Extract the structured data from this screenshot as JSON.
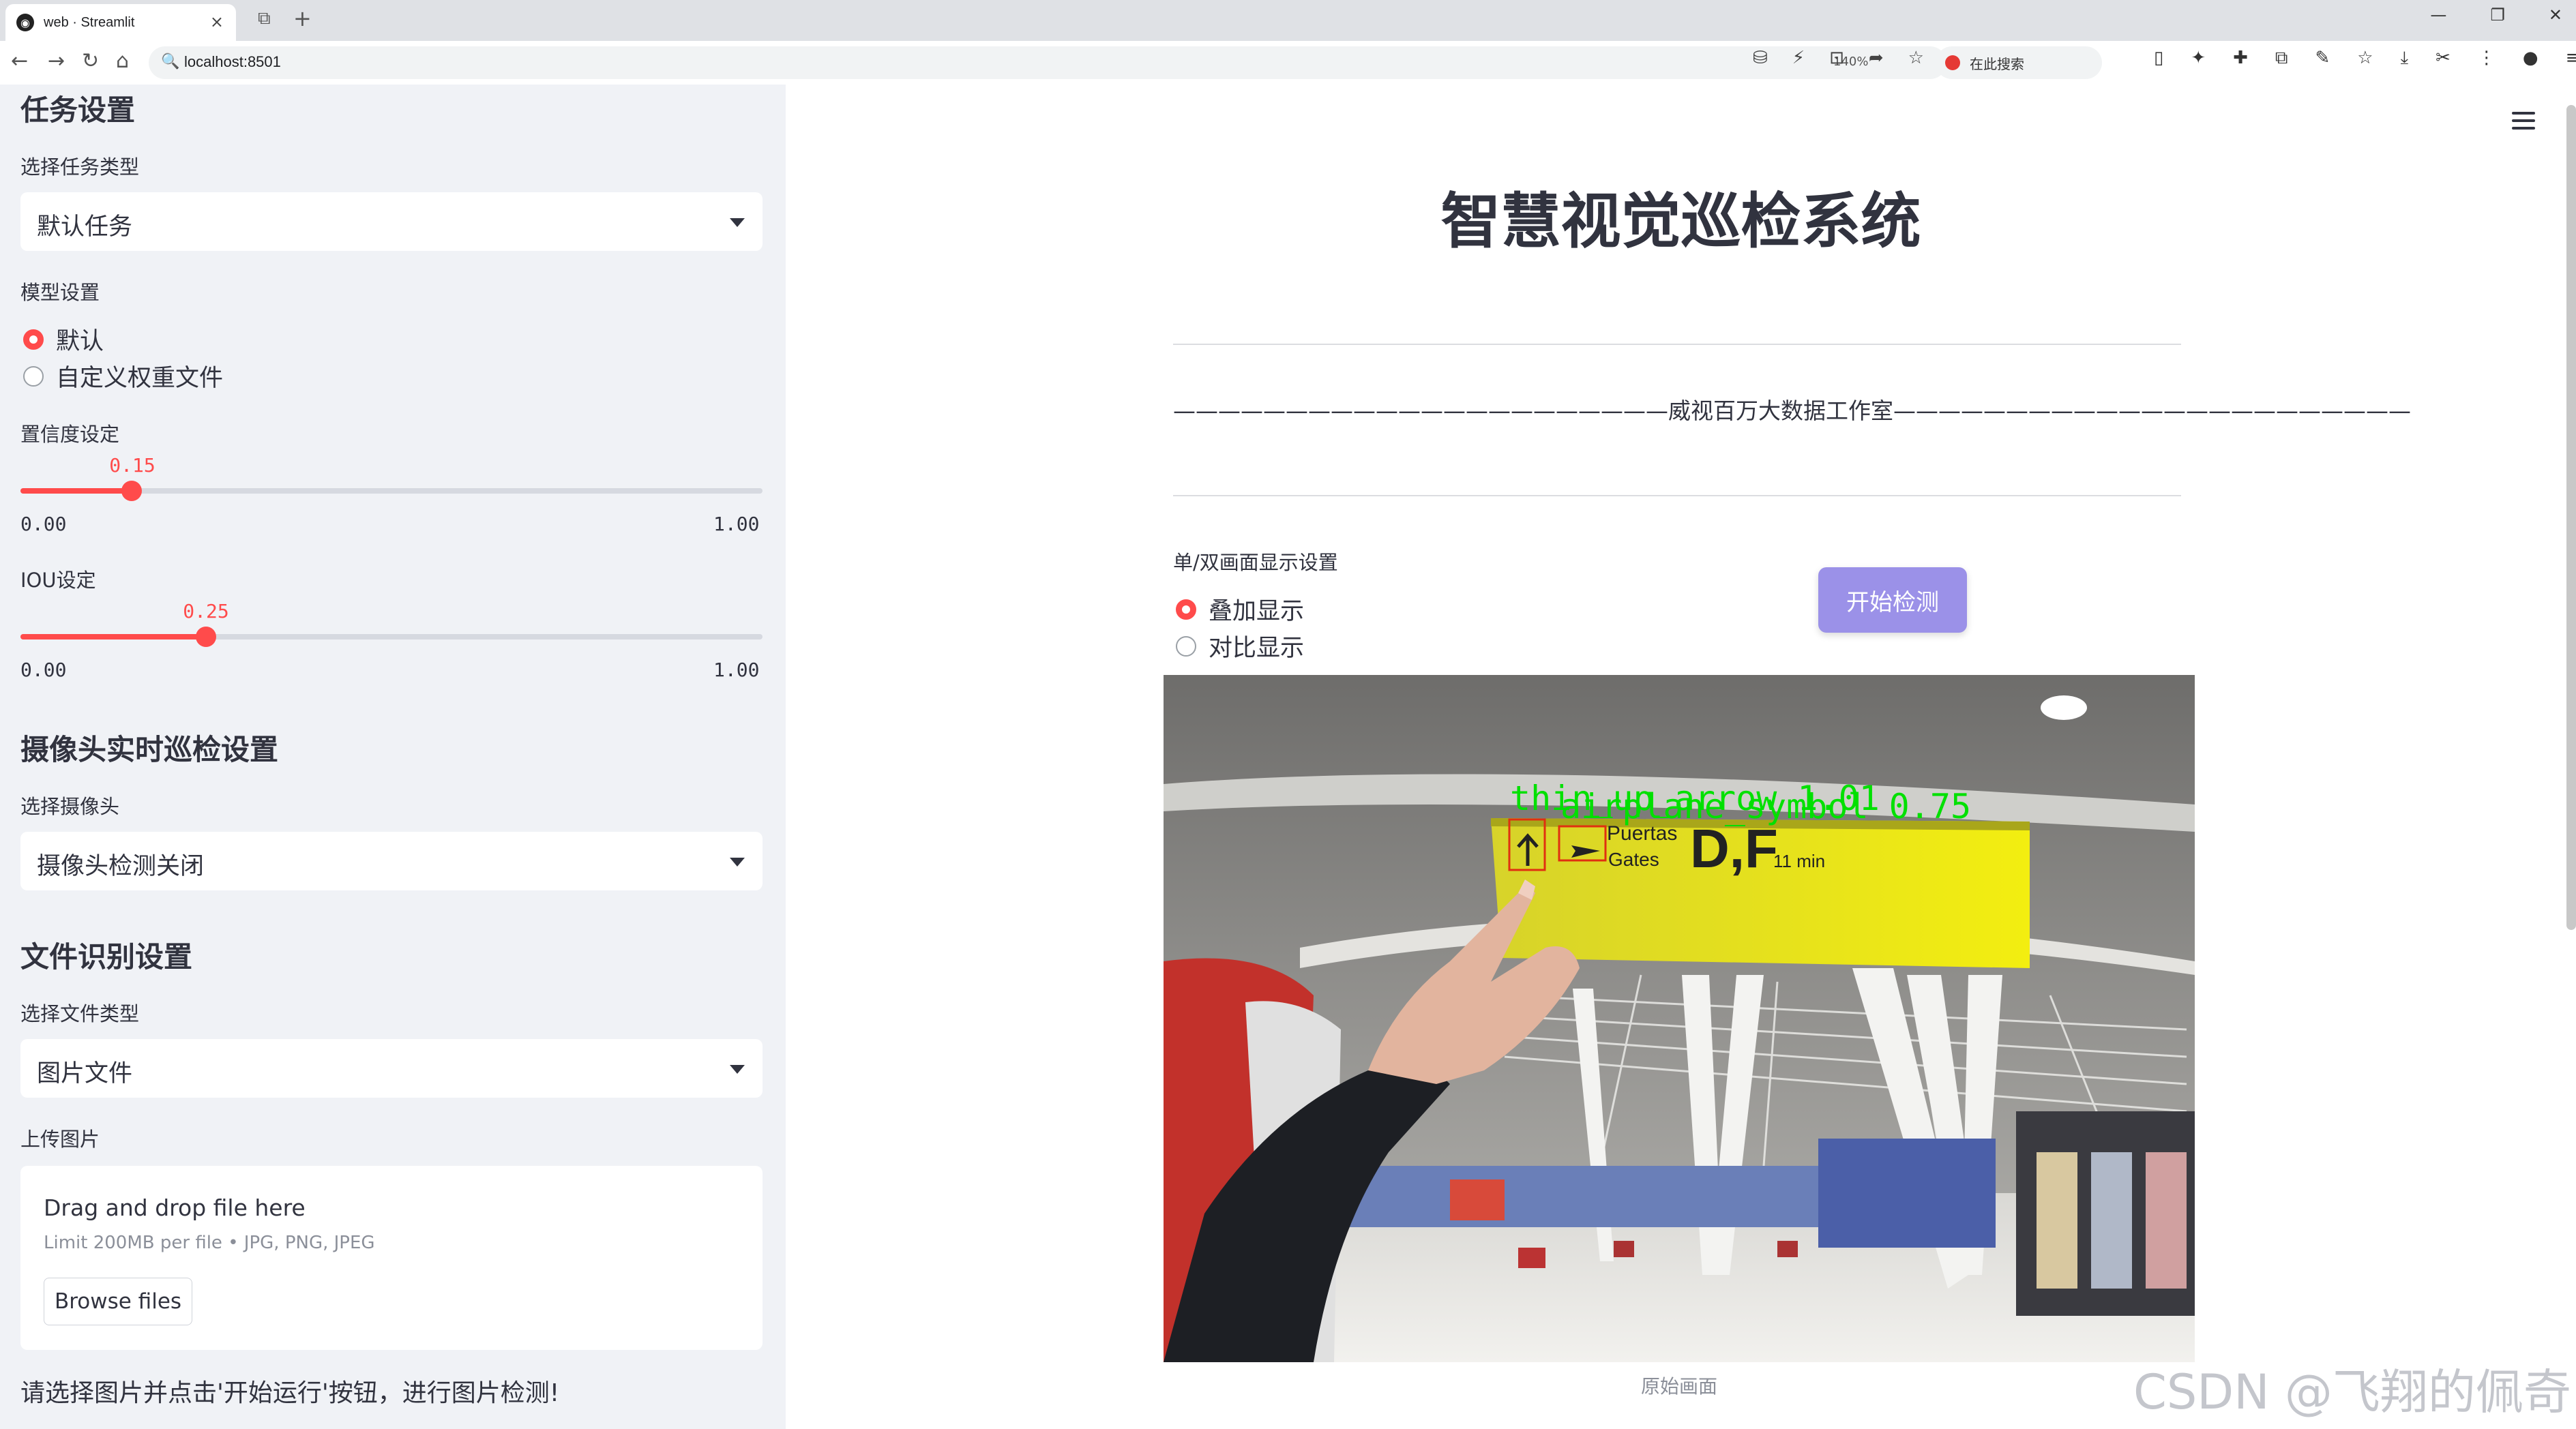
{
  "browser": {
    "tab_title": "web · Streamlit",
    "url": "localhost:8501",
    "zoom": "140%",
    "search_placeholder": "在此搜索"
  },
  "sidebar": {
    "task_section": "任务设置",
    "task_type_label": "选择任务类型",
    "task_type_value": "默认任务",
    "model_label": "模型设置",
    "model_options": [
      "默认",
      "自定义权重文件"
    ],
    "model_selected": 0,
    "conf_label": "置信度设定",
    "conf_value": "0.15",
    "conf_fraction": 0.15,
    "slider_min": "0.00",
    "slider_max": "1.00",
    "iou_label": "IOU设定",
    "iou_value": "0.25",
    "iou_fraction": 0.25,
    "camera_section": "摄像头实时巡检设置",
    "camera_label": "选择摄像头",
    "camera_value": "摄像头检测关闭",
    "file_section": "文件识别设置",
    "file_type_label": "选择文件类型",
    "file_type_value": "图片文件",
    "upload_label": "上传图片",
    "upload_title": "Drag and drop file here",
    "upload_limit": "Limit 200MB per file • JPG, PNG, JPEG",
    "browse_label": "Browse files",
    "hint": "请选择图片并点击'开始运行'按钮，进行图片检测!"
  },
  "main": {
    "title": "智慧视觉巡检系统",
    "studio_line": "——————————————————————威视百万大数据工作室———————————————————————",
    "display_mode_label": "单/双画面显示设置",
    "display_options": [
      "叠加显示",
      "对比显示"
    ],
    "display_selected": 0,
    "start_button": "开始检测",
    "caption": "原始画面",
    "sign_text_1": "Puertas",
    "sign_text_2": "Gates",
    "sign_gate": "D,F",
    "sign_walk": "11 min",
    "detections": [
      {
        "label": "thin_up_arrow 1.01",
        "color": "#00e000"
      },
      {
        "label": "airplane_symbol 0.75",
        "color": "#00e000"
      }
    ]
  },
  "watermark": "CSDN @飞翔的佩奇",
  "colors": {
    "accent": "#ff4b4b",
    "button": "#9b91e8",
    "sidebar_bg": "#f0f2f6"
  }
}
